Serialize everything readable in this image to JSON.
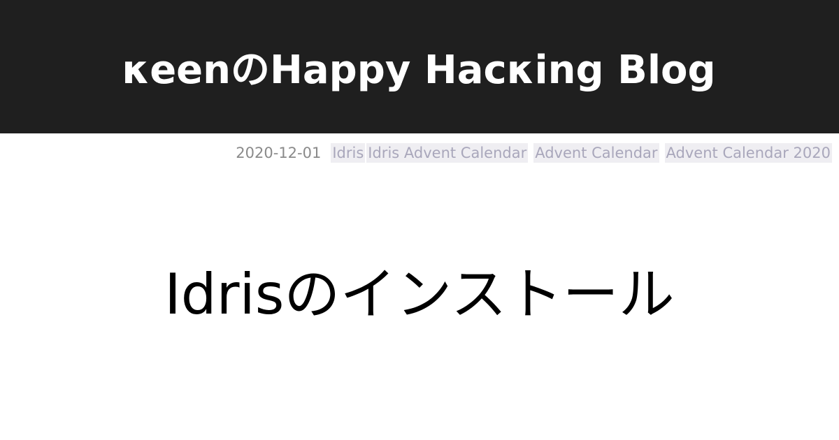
{
  "header": {
    "site_title": "κeenのHappy Hacκing Blog"
  },
  "meta": {
    "date": "2020-12-01",
    "tags": [
      "Idris",
      "Idris Advent Calendar",
      "Advent Calendar",
      "Advent Calendar 2020"
    ]
  },
  "post": {
    "title": "Idrisのインストール"
  },
  "colors": {
    "header_bg": "#1f1f1f",
    "header_text": "#ffffff",
    "date_text": "#8a8a8a",
    "tag_bg": "#efeef2",
    "tag_text": "#a9a7bb",
    "title_text": "#000000"
  }
}
